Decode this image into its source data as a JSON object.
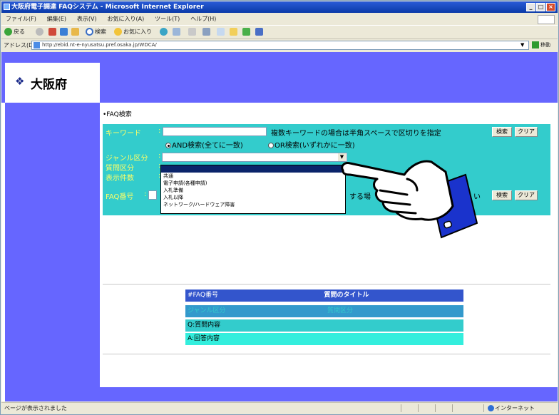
{
  "window": {
    "title": "大阪府電子調達 FAQシステム - Microsoft Internet Explorer",
    "min": "_",
    "max": "□",
    "close": "×"
  },
  "menu": [
    "ファイル(F)",
    "編集(E)",
    "表示(V)",
    "お気に入り(A)",
    "ツール(T)",
    "ヘルプ(H)"
  ],
  "toolbar": {
    "back": "戻る",
    "search": "検索",
    "favorites": "お気に入り"
  },
  "address": {
    "label": "アドレス(D)",
    "url": "http://ebid.nt-e-nyusatsu.pref.osaka.jp/WDCA/",
    "go": "移動"
  },
  "page": {
    "logo_text": "大阪府",
    "breadcrumb": "•FAQ検索",
    "keyword_label": "キーワード",
    "colon": ":",
    "keyword_value": "",
    "keyword_hint": "複数キーワードの場合は半角スペースで区切りを指定",
    "search_button": "検索",
    "clear_button": "クリア",
    "and_option": "AND検索(全てに一致)",
    "or_option": "OR検索(いずれかに一致)",
    "genre_label": "ジャンル区分",
    "question_label": "質問区分",
    "count_label": "表示件数",
    "faq_no_label": "FAQ番号",
    "faq_hint": "する場",
    "faq_hint2": "い",
    "search_button2": "検索",
    "clear_button2": "クリア",
    "dropdown_options": [
      "",
      "共通",
      "電子申請(各種申請)",
      "入札準備",
      "入札以降",
      "ネットワーク/ハードウェア障害"
    ]
  },
  "results": {
    "no_header": "#FAQ番号",
    "title_header": "質問のタイトル",
    "genre_header": "ジャンル区分",
    "qcat_header": "質問区分",
    "q_row": "Q:質問内容",
    "a_row": "A:回答内容"
  },
  "colors": {
    "header_band": "#6666ff",
    "panel": "#33cccc",
    "label_yellow": "#ffff66",
    "table_dark": "#3355cc",
    "table_mid": "#3399cc",
    "table_teal": "#33cccc"
  },
  "status": {
    "left": "ページが表示されました",
    "zone": "インターネット"
  }
}
